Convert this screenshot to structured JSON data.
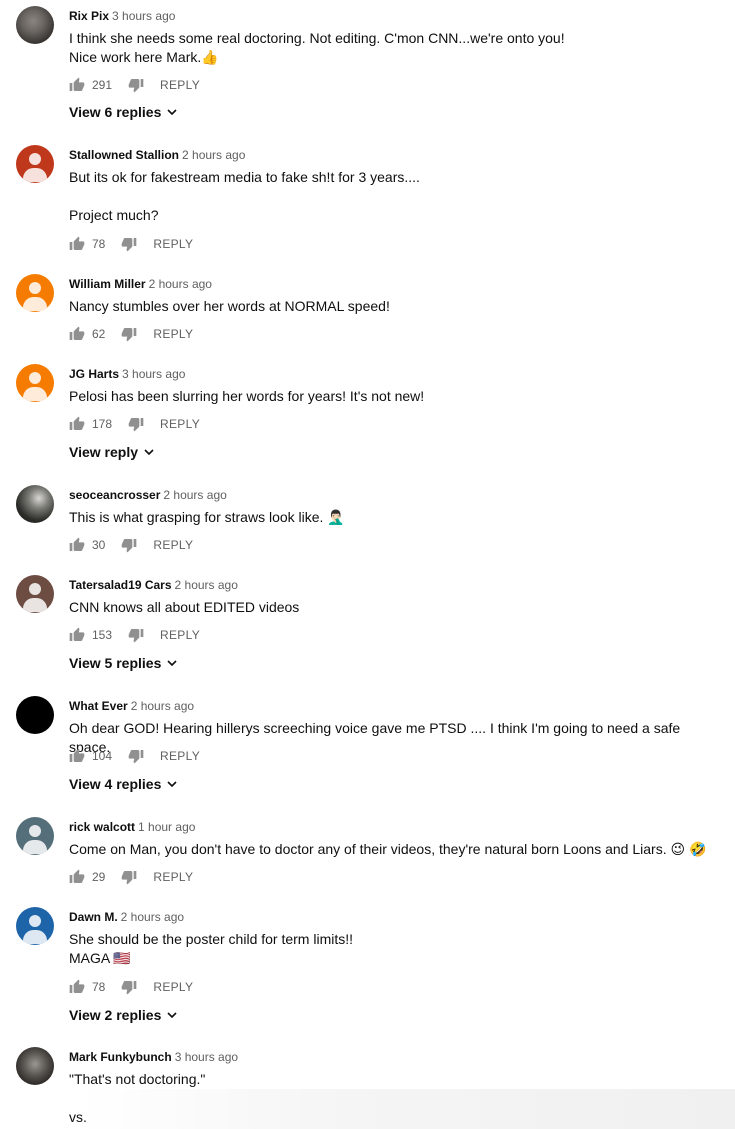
{
  "comments": [
    {
      "author": "Rix Pix",
      "time": "3 hours ago",
      "text": "I think she needs some real doctoring. Not editing. C'mon CNN...we're onto you!\nNice work here Mark.👍",
      "likes": "291",
      "reply_label": "REPLY",
      "view_replies": "View 6 replies",
      "avatar": {
        "kind": "photo",
        "color": "#5a5652"
      }
    },
    {
      "author": "Stallowned Stallion",
      "time": "2 hours ago",
      "text": "But its ok for fakestream media to fake sh!t for 3 years....\n\nProject much?",
      "likes": "78",
      "reply_label": "REPLY",
      "avatar": {
        "kind": "default",
        "color": "#c0381c"
      }
    },
    {
      "author": "William Miller",
      "time": "2 hours ago",
      "text": "Nancy stumbles over her words at NORMAL speed!",
      "likes": "62",
      "reply_label": "REPLY",
      "avatar": {
        "kind": "default",
        "color": "#f57c00"
      }
    },
    {
      "author": "JG Harts",
      "time": "3 hours ago",
      "text": "Pelosi has been slurring her words for years! It's not new!",
      "likes": "178",
      "reply_label": "REPLY",
      "view_replies": "View reply",
      "avatar": {
        "kind": "default",
        "color": "#f57c00"
      }
    },
    {
      "author": "seoceancrosser",
      "time": "2 hours ago",
      "text": "This is what grasping for straws look like. 🤦🏻‍♂️",
      "likes": "30",
      "reply_label": "REPLY",
      "avatar": {
        "kind": "photo",
        "color": "#2d2d2a"
      }
    },
    {
      "author": "Tatersalad19 Cars",
      "time": "2 hours ago",
      "text": "CNN knows all about EDITED videos",
      "likes": "153",
      "reply_label": "REPLY",
      "view_replies": "View 5 replies",
      "avatar": {
        "kind": "default",
        "color": "#6d4c41"
      }
    },
    {
      "author": "What Ever",
      "time": "2 hours ago",
      "text": "Oh dear GOD! Hearing hillerys screeching voice gave me PTSD .... I think I'm going to need a safe space.",
      "likes": "104",
      "reply_label": "REPLY",
      "view_replies": "View 4 replies",
      "avatar": {
        "kind": "solid",
        "color": "#000000"
      }
    },
    {
      "author": "rick walcott",
      "time": "1 hour ago",
      "text": "Come on Man, you don't have to doctor any of their videos, they're natural born Loons and Liars. 😉 🤣",
      "likes": "29",
      "reply_label": "REPLY",
      "avatar": {
        "kind": "default",
        "color": "#546e7a"
      }
    },
    {
      "author": "Dawn M.",
      "time": "2 hours ago",
      "text": "She should be the poster child for term limits!!\nMAGA 🇺🇸",
      "likes": "78",
      "reply_label": "REPLY",
      "view_replies": "View 2 replies",
      "avatar": {
        "kind": "default",
        "color": "#1e64a8"
      }
    },
    {
      "author": "Mark Funkybunch",
      "time": "3 hours ago",
      "text": "\"That's not doctoring.\"\n\nvs.",
      "avatar": {
        "kind": "photo",
        "color": "#3a3633"
      }
    }
  ],
  "colors": {
    "text": "#0f0f0f",
    "secondary": "#606060",
    "background": "#ffffff"
  },
  "icons": {
    "like": "thumb-up-icon",
    "dislike": "thumb-down-icon",
    "expand": "chevron-down-icon"
  }
}
